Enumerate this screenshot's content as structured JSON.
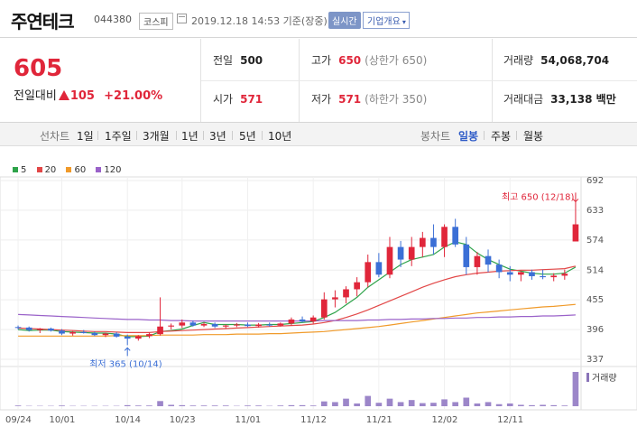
{
  "header": {
    "name": "주연테크",
    "code": "044380",
    "market": "코스피",
    "timestamp": "2019.12.18 14:53 기준(장중)",
    "realtime_label": "실시간",
    "profile_label": "기업개요"
  },
  "quote": {
    "price": "605",
    "change_label": "전일대비",
    "change": "105",
    "change_pct": "+21.00%",
    "prev_label": "전일",
    "prev": "500",
    "high_label": "고가",
    "high": "650",
    "upper_limit": "(상한가 650)",
    "volume_label": "거래량",
    "volume": "54,068,704",
    "open_label": "시가",
    "open": "571",
    "low_label": "저가",
    "low": "571",
    "lower_limit": "(하한가 350)",
    "amount_label": "거래대금",
    "amount": "33,138 백만"
  },
  "periods": {
    "line_label": "선차트",
    "line_items": [
      "1일",
      "1주일",
      "3개월",
      "1년",
      "3년",
      "5년",
      "10년"
    ],
    "candle_label": "봉차트",
    "candle_items": [
      "일봉",
      "주봉",
      "월봉"
    ],
    "candle_selected": "일봉"
  },
  "legend": [
    {
      "name": "5",
      "color": "#2ea34a"
    },
    {
      "name": "20",
      "color": "#e24747"
    },
    {
      "name": "60",
      "color": "#f09a2a"
    },
    {
      "name": "120",
      "color": "#9a62c9"
    }
  ],
  "annotations": {
    "high_label": "최고 650 (12/18)",
    "low_label": "최저 365 (10/14)"
  },
  "volume_label": "거래량",
  "colors": {
    "up": "#e0263a",
    "down": "#3b6fd6",
    "accent": "#2e5bc7"
  },
  "chart_data": {
    "type": "candlestick",
    "yticks": [
      692,
      633,
      574,
      514,
      455,
      396,
      337
    ],
    "ylim": [
      337,
      692
    ],
    "x_tick_labels": [
      {
        "label": "09/24",
        "index": 0
      },
      {
        "label": "10/01",
        "index": 4
      },
      {
        "label": "10/14",
        "index": 10
      },
      {
        "label": "10/23",
        "index": 15
      },
      {
        "label": "11/01",
        "index": 21
      },
      {
        "label": "11/12",
        "index": 27
      },
      {
        "label": "11/21",
        "index": 33
      },
      {
        "label": "12/02",
        "index": 39
      },
      {
        "label": "12/11",
        "index": 45
      }
    ],
    "candles": [
      [
        401,
        404,
        396,
        400
      ],
      [
        400,
        402,
        392,
        395
      ],
      [
        395,
        399,
        389,
        398
      ],
      [
        398,
        400,
        392,
        394
      ],
      [
        394,
        397,
        385,
        388
      ],
      [
        388,
        393,
        384,
        391
      ],
      [
        391,
        395,
        388,
        389
      ],
      [
        389,
        392,
        383,
        385
      ],
      [
        385,
        390,
        381,
        388
      ],
      [
        388,
        391,
        380,
        382
      ],
      [
        382,
        386,
        365,
        378
      ],
      [
        378,
        385,
        374,
        383
      ],
      [
        383,
        390,
        379,
        387
      ],
      [
        387,
        460,
        384,
        402
      ],
      [
        402,
        408,
        396,
        404
      ],
      [
        404,
        416,
        399,
        410
      ],
      [
        410,
        414,
        402,
        404
      ],
      [
        404,
        410,
        401,
        407
      ],
      [
        407,
        410,
        399,
        402
      ],
      [
        402,
        406,
        398,
        404
      ],
      [
        404,
        409,
        401,
        406
      ],
      [
        406,
        410,
        401,
        403
      ],
      [
        403,
        409,
        400,
        406
      ],
      [
        406,
        410,
        402,
        404
      ],
      [
        404,
        410,
        402,
        408
      ],
      [
        408,
        420,
        404,
        416
      ],
      [
        416,
        422,
        410,
        412
      ],
      [
        412,
        424,
        408,
        420
      ],
      [
        420,
        470,
        416,
        456
      ],
      [
        456,
        474,
        440,
        460
      ],
      [
        460,
        482,
        448,
        476
      ],
      [
        476,
        500,
        462,
        490
      ],
      [
        490,
        545,
        480,
        530
      ],
      [
        530,
        548,
        500,
        505
      ],
      [
        505,
        580,
        498,
        560
      ],
      [
        560,
        572,
        520,
        535
      ],
      [
        535,
        580,
        522,
        560
      ],
      [
        560,
        590,
        540,
        578
      ],
      [
        578,
        605,
        545,
        560
      ],
      [
        560,
        605,
        540,
        600
      ],
      [
        600,
        616,
        560,
        565
      ],
      [
        565,
        580,
        505,
        520
      ],
      [
        520,
        550,
        505,
        542
      ],
      [
        542,
        555,
        510,
        525
      ],
      [
        525,
        535,
        498,
        510
      ],
      [
        510,
        522,
        492,
        505
      ],
      [
        505,
        512,
        492,
        510
      ],
      [
        510,
        515,
        495,
        502
      ],
      [
        502,
        515,
        496,
        500
      ],
      [
        500,
        508,
        492,
        503
      ],
      [
        503,
        515,
        495,
        507
      ],
      [
        571,
        650,
        571,
        605
      ]
    ],
    "ma": {
      "5": [
        396,
        394,
        395,
        395,
        392,
        391,
        390,
        389,
        389,
        387,
        382,
        382,
        383,
        392,
        394,
        397,
        404,
        410,
        406,
        406,
        406,
        405,
        405,
        406,
        406,
        408,
        410,
        412,
        420,
        430,
        445,
        460,
        480,
        495,
        510,
        525,
        535,
        540,
        545,
        560,
        570,
        565,
        548,
        535,
        525,
        516,
        512,
        508,
        506,
        506,
        508,
        520
      ],
      "20": [
        399,
        398,
        397,
        396,
        395,
        394,
        393,
        392,
        392,
        391,
        390,
        390,
        390,
        392,
        393,
        394,
        395,
        396,
        397,
        398,
        399,
        400,
        401,
        402,
        403,
        404,
        405,
        407,
        410,
        414,
        420,
        427,
        435,
        444,
        453,
        462,
        471,
        480,
        488,
        495,
        501,
        505,
        508,
        510,
        512,
        513,
        514,
        514,
        515,
        516,
        517,
        522
      ],
      "60": [
        383,
        383,
        383,
        383,
        383,
        383,
        383,
        383,
        383,
        384,
        384,
        384,
        384,
        385,
        385,
        385,
        385,
        386,
        386,
        386,
        387,
        387,
        387,
        388,
        388,
        389,
        390,
        391,
        392,
        394,
        396,
        398,
        400,
        402,
        405,
        408,
        411,
        414,
        417,
        420,
        423,
        426,
        429,
        431,
        433,
        435,
        437,
        439,
        441,
        442,
        444,
        446
      ],
      "120": [
        426,
        425,
        424,
        423,
        422,
        421,
        420,
        419,
        418,
        417,
        416,
        416,
        415,
        415,
        414,
        414,
        413,
        413,
        413,
        413,
        413,
        413,
        413,
        413,
        413,
        413,
        413,
        413,
        414,
        414,
        414,
        414,
        415,
        415,
        416,
        416,
        417,
        417,
        418,
        418,
        419,
        419,
        420,
        420,
        421,
        421,
        422,
        422,
        423,
        423,
        424,
        425
      ]
    },
    "volume": [
      2,
      1,
      1,
      1,
      2,
      1,
      1,
      1,
      1,
      1,
      3,
      2,
      2,
      15,
      4,
      3,
      2,
      2,
      2,
      2,
      1,
      2,
      2,
      1,
      2,
      3,
      3,
      2,
      14,
      12,
      22,
      8,
      30,
      10,
      22,
      12,
      18,
      9,
      10,
      20,
      12,
      25,
      8,
      12,
      6,
      8,
      4,
      3,
      4,
      3,
      2,
      100
    ]
  }
}
